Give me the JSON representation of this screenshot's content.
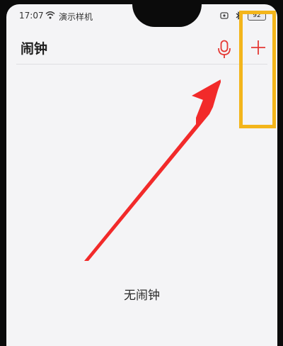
{
  "status_bar": {
    "time": "17:07",
    "carrier": "演示样机",
    "battery_level": "92",
    "icons": [
      "wifi-icon",
      "alarm-status-icon",
      "bluetooth-icon",
      "battery-icon"
    ]
  },
  "header": {
    "title": "闹钟",
    "mic_icon": "microphone-icon",
    "add_icon": "plus-icon"
  },
  "main": {
    "empty_text": "无闹钟"
  },
  "colors": {
    "accent": "#e53935",
    "annotation_highlight": "#f3b51b",
    "annotation_arrow": "#f22a2a",
    "background": "#f4f4f6"
  }
}
